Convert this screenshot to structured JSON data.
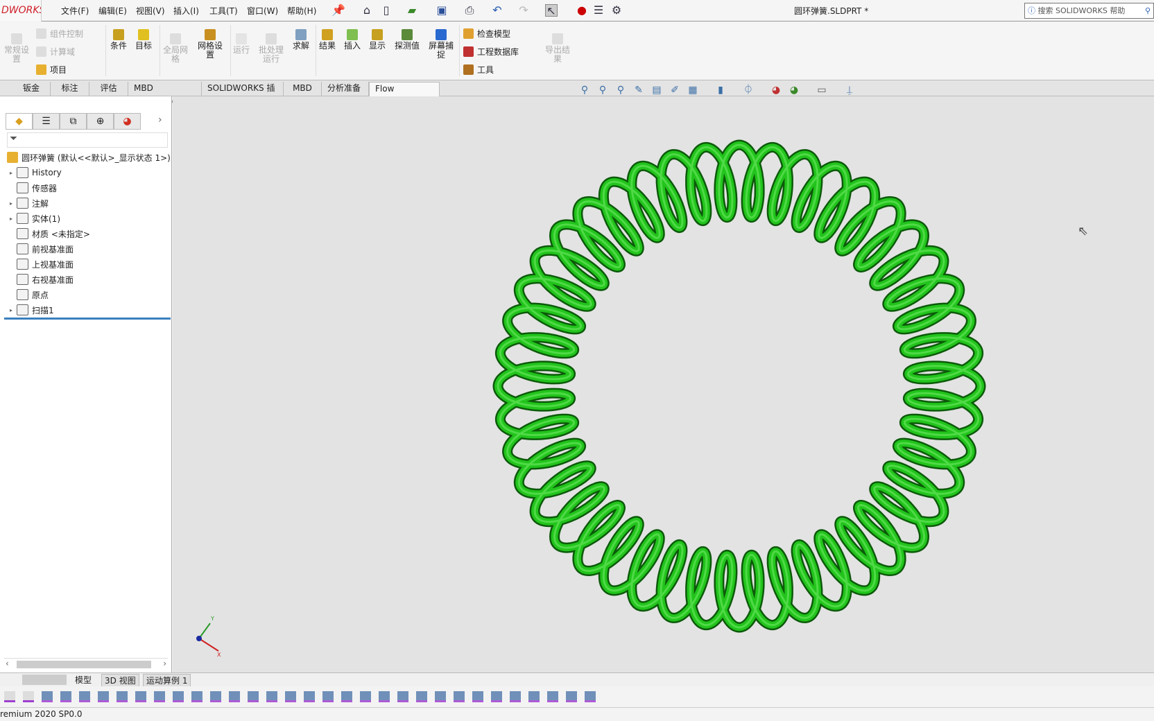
{
  "app": {
    "logo": "DWORKS",
    "document_title": "圆环弹簧.SLDPRT *",
    "search_placeholder": "搜索 SOLIDWORKS 帮助"
  },
  "menu": [
    "文件(F)",
    "编辑(E)",
    "视图(V)",
    "插入(I)",
    "工具(T)",
    "窗口(W)",
    "帮助(H)"
  ],
  "ribbon": {
    "general_settings": "常规设置",
    "component_control": "组件控制",
    "computational_domain": "计算域",
    "project": "项目",
    "conditions": "条件",
    "goals": "目标",
    "global_mesh": "全局网格",
    "mesh_settings": "网格设置",
    "run": "运行",
    "batch_run": "批处理运行",
    "solve": "求解",
    "results": "结果",
    "insert": "插入",
    "display": "显示",
    "probe": "探测值",
    "screen_capture": "屏幕捕捉",
    "check_model": "检查模型",
    "engineering_database": "工程数据库",
    "tools": "工具",
    "export_results": "导出结果"
  },
  "tabs": [
    "钣金",
    "标注",
    "评估",
    "MBD Dimensions",
    "SOLIDWORKS 插件",
    "MBD",
    "分析准备",
    "Flow Simulation"
  ],
  "active_tab": "Flow Simulation",
  "tree": {
    "root": "圆环弹簧  (默认<<默认>_显示状态 1>)",
    "items": [
      {
        "label": "History",
        "expandable": true
      },
      {
        "label": "传感器",
        "expandable": false
      },
      {
        "label": "注解",
        "expandable": true
      },
      {
        "label": "实体(1)",
        "expandable": true
      },
      {
        "label": "材质 <未指定>",
        "expandable": false
      },
      {
        "label": "前视基准面",
        "expandable": false
      },
      {
        "label": "上视基准面",
        "expandable": false
      },
      {
        "label": "右视基准面",
        "expandable": false
      },
      {
        "label": "原点",
        "expandable": false
      },
      {
        "label": "扫描1",
        "expandable": true
      }
    ]
  },
  "bottom_tabs": [
    "模型",
    "3D 视图",
    "运动算例 1"
  ],
  "status": "remium 2020 SP0.0",
  "triad": {
    "x": "X",
    "y": "Y"
  },
  "colors": {
    "spring": "#22c41c",
    "spring_dark": "#0c5a0a",
    "viewport": "#e3e3e3",
    "logo": "#d0202a"
  }
}
